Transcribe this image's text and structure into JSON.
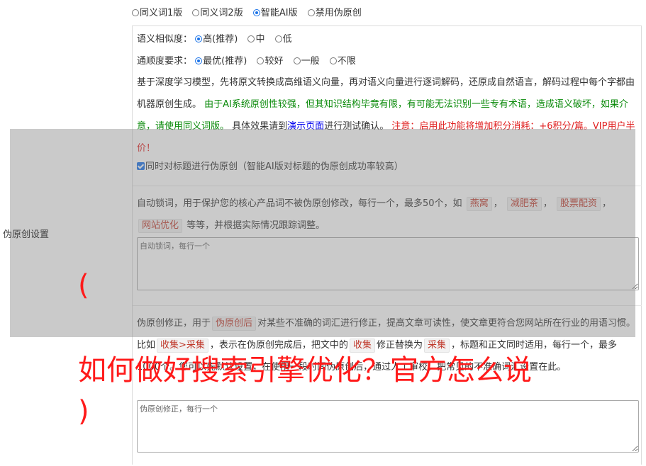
{
  "versions": {
    "options": [
      "同义词1版",
      "同义词2版",
      "智能AI版",
      "禁用伪原创"
    ],
    "selected_index": 2
  },
  "similarity": {
    "label": "语义相似度：",
    "options": [
      "高(推荐)",
      "中",
      "低"
    ],
    "selected_index": 0
  },
  "fluency": {
    "label": "通顺度要求：",
    "options": [
      "最优(推荐)",
      "较好",
      "一般",
      "不限"
    ],
    "selected_index": 0
  },
  "description": {
    "part1": "基于深度学习模型，先将原文转换成高维语义向量，再对语义向量进行逐词解码，还原成自然语言，解码过程中每个字都由机器原创生成。",
    "green": "由于AI系统原创性较强，但其知识结构毕竟有限，有可能无法识别一些专有术语，造成语义破坏，如果介意，请使用同义词版。",
    "part2": "具体效果请到",
    "link": "演示页面",
    "part3": "进行测试确认。",
    "red": "注意：启用此功能将增加积分消耗：+6积分/篇。VIP用户半价！"
  },
  "title_checkbox": {
    "label": "同时对标题进行伪原创（智能AI版对标题的伪原创成功率较高）",
    "checked": true
  },
  "side_label": "伪原创设置",
  "lock_words": {
    "desc_before": "自动锁词，用于保护您的核心产品词不被伪原创修改，每行一个，最多50个，如",
    "examples": [
      "燕窝",
      "减肥茶",
      "股票配资",
      "网站优化"
    ],
    "desc_after": "等等，并根据实际情况跟踪调整。",
    "placeholder": "自动锁词，每行一个"
  },
  "correction": {
    "desc1": "伪原创修正，用于",
    "tag1": "伪原创后",
    "desc2": "对某些不准确的词汇进行修正，提高文章可读性，使文章更符合您网站所在行业的用语习惯。比如",
    "tag2": "收集>采集",
    "desc3": "，表示在伪原创完成后，把文中的",
    "tag3": "收集",
    "desc4": "修正替换为",
    "tag4": "采集",
    "desc5": "，标题和正文同时适用，每行一个，最多1000个。您可以先默认设置，在使用一段时间伪原创后，通过人工审校，把常见的不准确词汇设置在此。",
    "placeholder": "伪原创修正，每行一个"
  },
  "headline": {
    "open": "(",
    "text": "如何做好搜索引擎优化？官方怎么说",
    "close": ")"
  },
  "colors": {
    "accent": "#1a73e8",
    "green_text": "#0a8a0a",
    "link_blue": "#0000ee",
    "red_text": "#e02020",
    "headline_red": "#ff1a1a",
    "overlay": "rgba(128,128,128,0.42)"
  }
}
